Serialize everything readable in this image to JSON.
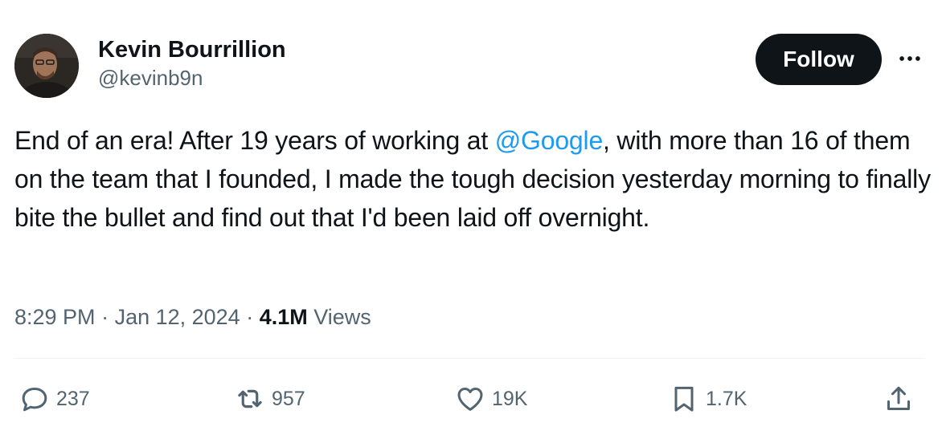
{
  "author": {
    "display_name": "Kevin Bourrillion",
    "handle": "@kevinb9n",
    "avatar_icon": "profile-photo"
  },
  "follow_button": {
    "label": "Follow"
  },
  "more_menu": {
    "icon": "more-horizontal-icon"
  },
  "tweet": {
    "text_before": "End of an era! After 19 years of working at ",
    "mention": "@Google",
    "text_after": ", with more than 16 of them on the team that I founded, I made the tough decision yesterday morning to finally bite the bullet and find out that I'd been laid off overnight."
  },
  "meta": {
    "time": "8:29 PM",
    "separator": " · ",
    "date": "Jan 12, 2024",
    "views_count": "4.1M",
    "views_label": " Views"
  },
  "actions": {
    "replies": {
      "icon": "reply-icon",
      "count": "237"
    },
    "reposts": {
      "icon": "repost-icon",
      "count": "957"
    },
    "likes": {
      "icon": "heart-icon",
      "count": "19K"
    },
    "bookmarks": {
      "icon": "bookmark-icon",
      "count": "1.7K"
    },
    "share": {
      "icon": "share-icon"
    }
  },
  "colors": {
    "text": "#0f1419",
    "secondary": "#536471",
    "link": "#1d9bf0",
    "button_bg": "#0f1419",
    "divider": "#eff3f4"
  }
}
